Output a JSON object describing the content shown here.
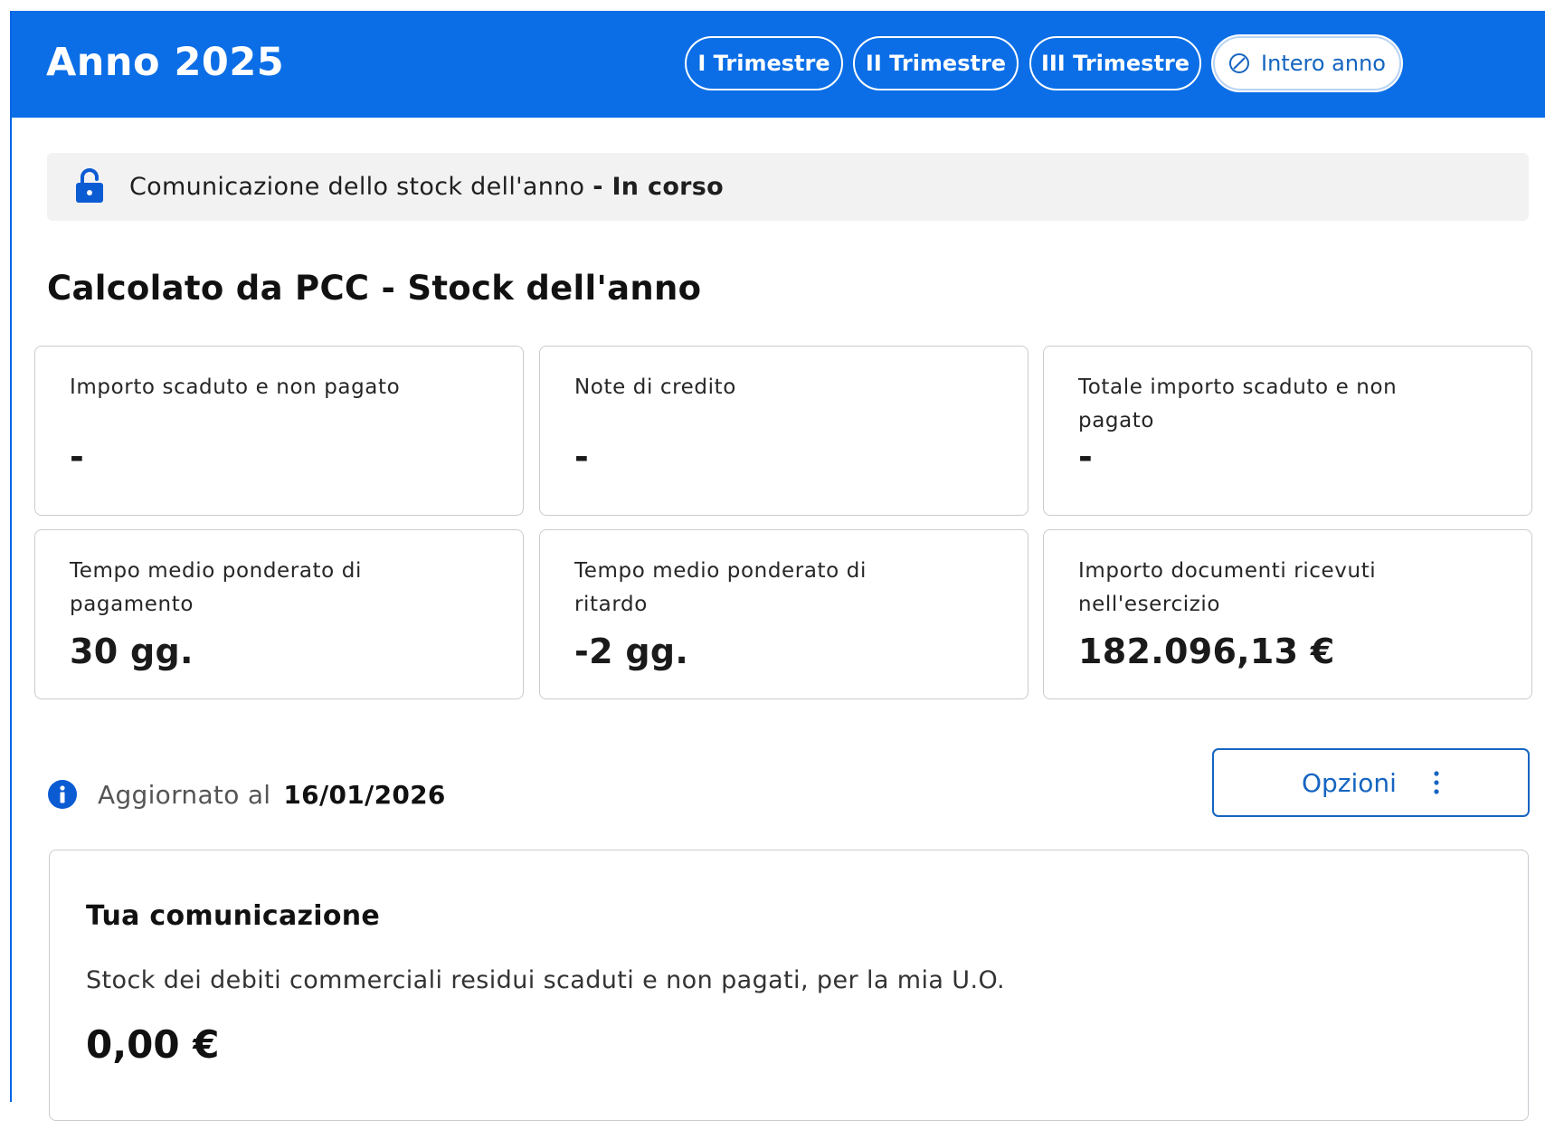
{
  "header": {
    "title": "Anno 2025",
    "tabs": [
      {
        "label": "I Trimestre",
        "active": false
      },
      {
        "label": "II Trimestre",
        "active": false
      },
      {
        "label": "III Trimestre",
        "active": false
      },
      {
        "label": "Intero anno",
        "active": true,
        "icon": "disabled-circle-icon"
      }
    ]
  },
  "status": {
    "icon": "lock-icon",
    "text": "Comunicazione dello stock dell'anno",
    "state": "- In corso"
  },
  "section_title": "Calcolato da PCC - Stock dell'anno",
  "cards": [
    {
      "label": "Importo scaduto e non pagato",
      "value": "-"
    },
    {
      "label": "Note di credito",
      "value": "-"
    },
    {
      "label": "Totale importo scaduto e non pagato",
      "value": "-"
    },
    {
      "label": "Tempo medio ponderato di pagamento",
      "value": "30 gg."
    },
    {
      "label": "Tempo medio ponderato di ritardo",
      "value": "-2 gg."
    },
    {
      "label": "Importo documenti ricevuti nell'esercizio",
      "value": "182.096,13 €"
    }
  ],
  "updated": {
    "icon": "info-icon",
    "label": "Aggiornato al",
    "date": "16/01/2026"
  },
  "options_button": {
    "label": "Opzioni",
    "icon": "kebab-menu-icon"
  },
  "communication": {
    "title": "Tua comunicazione",
    "description": "Stock dei debiti commerciali residui scaduti e non pagati, per la mia U.O.",
    "amount": "0,00 €"
  },
  "colors": {
    "primary": "#0b6ee6",
    "link": "#1565c0",
    "status_bg": "#f2f2f3",
    "border": "#c9cbd0"
  }
}
